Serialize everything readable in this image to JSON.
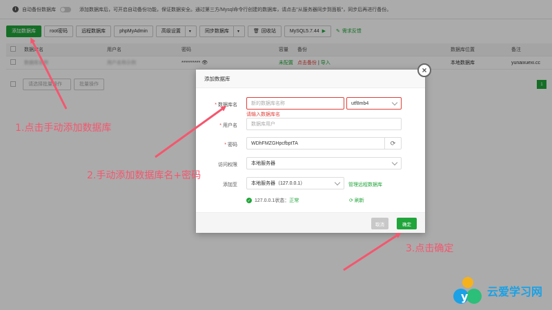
{
  "notice": {
    "backup_label": "自动备份数据库",
    "text": "添加数据库后，可开启自动备份功能，保证数据安全。通过第三方/Mysql命令行创建的数据库，请点击\"从服务器同步到面板\"，同步后再进行备份。"
  },
  "toolbar": {
    "add_db": "添加数据库",
    "root_pwd": "root密码",
    "remote_db": "远程数据库",
    "phpmyadmin": "phpMyAdmin",
    "advanced": "高级设置",
    "sync": "同步数据库",
    "recycle": "回收站",
    "mysql_version": "MySQL5.7.44",
    "feedback": "需求反馈"
  },
  "table": {
    "headers": [
      "数据库名",
      "用户名",
      "密码",
      "容量",
      "备份",
      "数据库位置",
      "备注"
    ],
    "row": {
      "name": "数据库名称",
      "user": "用户名称示例",
      "password": "**********",
      "capacity": "未配置",
      "backup_none": "点击备份",
      "import": "导入",
      "location": "本地数据库",
      "remark": "yunaixuexi.cc"
    },
    "batch_placeholder": "请选择批量操作",
    "batch_btn": "批量操作",
    "page": "1"
  },
  "dialog": {
    "title": "添加数据库",
    "db_name_label": "数据库名",
    "db_name_placeholder": "新的数据库名称",
    "charset": "utf8mb4",
    "db_name_error": "请输入数据库名",
    "user_label": "用户名",
    "user_placeholder": "数据库用户",
    "pwd_label": "密码",
    "pwd_value": "WDhFMZGHpcfbptTA",
    "access_label": "访问权限",
    "access_value": "本地服务器",
    "add_to_label": "添加至",
    "add_to_value": "本地服务器（127.0.0.1）",
    "manage_remote": "管理远程数据库",
    "status_text": "127.0.0.1状态：",
    "status_value": "正常",
    "refresh": "刷新",
    "cancel": "取消",
    "confirm": "确定"
  },
  "annotations": {
    "step1": "1.点击手动添加数据库",
    "step2": "2.手动添加数据库名+密码",
    "step3": "3.点击确定"
  },
  "logo": {
    "text": "云爱学习网"
  },
  "colors": {
    "accent": "#20a53a",
    "error": "#e0403a",
    "annotation": "#f5566e"
  }
}
